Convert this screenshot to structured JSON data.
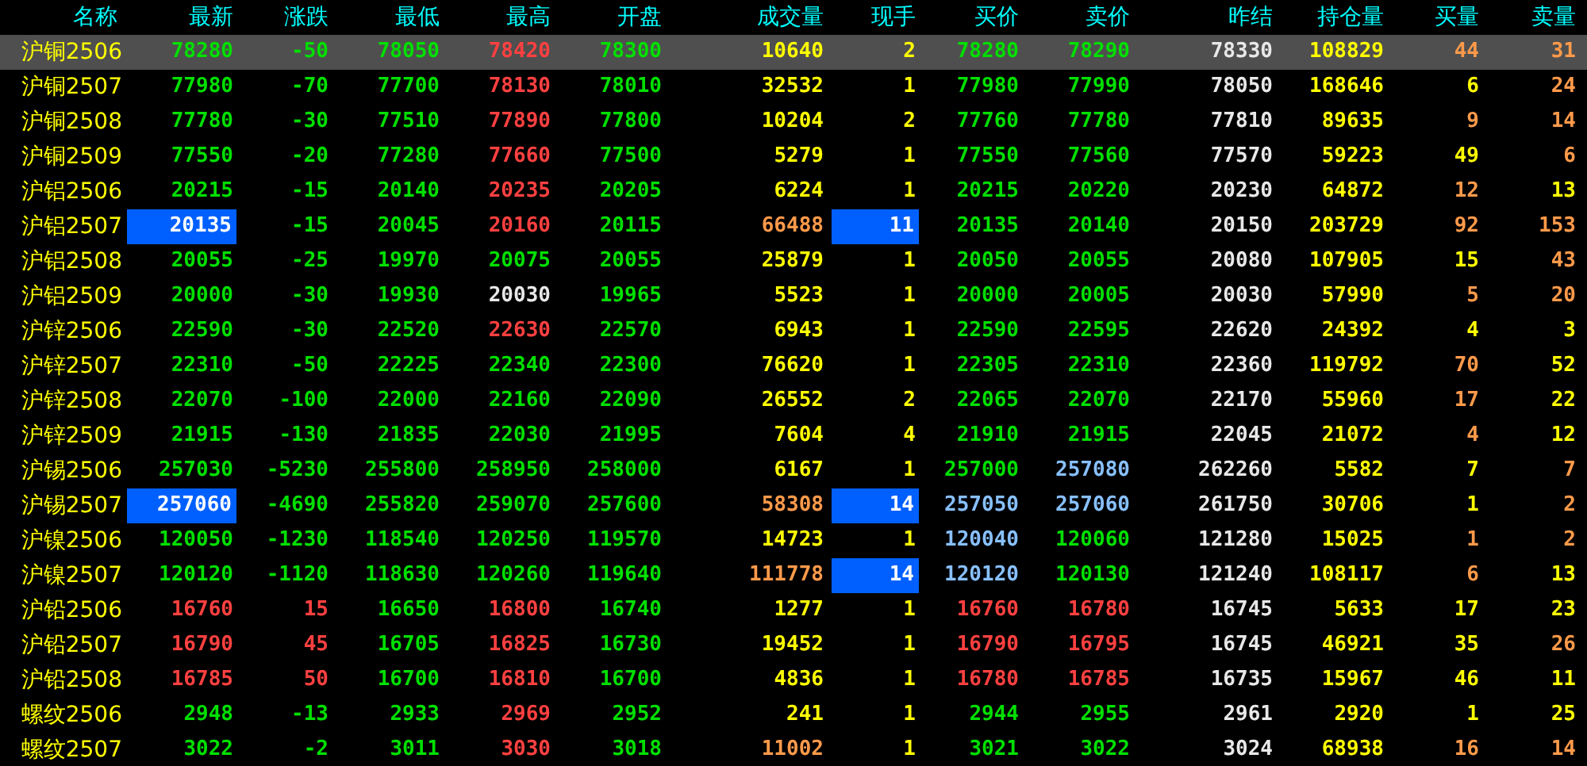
{
  "table": {
    "name_header": "名称",
    "columns": [
      "最新",
      "涨跌",
      "最低",
      "最高",
      "开盘",
      "成交量",
      "现手",
      "买价",
      "卖价",
      "昨结",
      "持仓量",
      "买量",
      "卖量"
    ],
    "rows": [
      {
        "name": "沪铜2506",
        "selected": true,
        "cells": [
          {
            "text": "78280",
            "color": "#00e000",
            "highlighted": false
          },
          {
            "text": "-50",
            "color": "#00e000",
            "highlighted": false
          },
          {
            "text": "78050",
            "color": "#00e000",
            "highlighted": false
          },
          {
            "text": "78420",
            "color": "#ff4040",
            "highlighted": false
          },
          {
            "text": "78300",
            "color": "#00e000",
            "highlighted": false
          },
          {
            "text": "10640",
            "color": "#ffff00",
            "highlighted": false
          },
          {
            "text": "2",
            "color": "#ffff00",
            "highlighted": false
          },
          {
            "text": "78280",
            "color": "#00e000",
            "highlighted": false
          },
          {
            "text": "78290",
            "color": "#00e000",
            "highlighted": false
          },
          {
            "text": "78330",
            "color": "#e8e8e8",
            "highlighted": false
          },
          {
            "text": "108829",
            "color": "#ffff00",
            "highlighted": false
          },
          {
            "text": "44",
            "color": "#ff9a4a",
            "highlighted": false
          },
          {
            "text": "31",
            "color": "#ff9a4a",
            "highlighted": false
          }
        ]
      },
      {
        "name": "沪铜2507",
        "selected": false,
        "cells": [
          {
            "text": "77980",
            "color": "#00e000",
            "highlighted": false
          },
          {
            "text": "-70",
            "color": "#00e000",
            "highlighted": false
          },
          {
            "text": "77700",
            "color": "#00e000",
            "highlighted": false
          },
          {
            "text": "78130",
            "color": "#ff4040",
            "highlighted": false
          },
          {
            "text": "78010",
            "color": "#00e000",
            "highlighted": false
          },
          {
            "text": "32532",
            "color": "#ffff00",
            "highlighted": false
          },
          {
            "text": "1",
            "color": "#ffff00",
            "highlighted": false
          },
          {
            "text": "77980",
            "color": "#00e000",
            "highlighted": false
          },
          {
            "text": "77990",
            "color": "#00e000",
            "highlighted": false
          },
          {
            "text": "78050",
            "color": "#e8e8e8",
            "highlighted": false
          },
          {
            "text": "168646",
            "color": "#ffff00",
            "highlighted": false
          },
          {
            "text": "6",
            "color": "#ffff00",
            "highlighted": false
          },
          {
            "text": "24",
            "color": "#ff9a4a",
            "highlighted": false
          }
        ]
      },
      {
        "name": "沪铜2508",
        "selected": false,
        "cells": [
          {
            "text": "77780",
            "color": "#00e000",
            "highlighted": false
          },
          {
            "text": "-30",
            "color": "#00e000",
            "highlighted": false
          },
          {
            "text": "77510",
            "color": "#00e000",
            "highlighted": false
          },
          {
            "text": "77890",
            "color": "#ff4040",
            "highlighted": false
          },
          {
            "text": "77800",
            "color": "#00e000",
            "highlighted": false
          },
          {
            "text": "10204",
            "color": "#ffff00",
            "highlighted": false
          },
          {
            "text": "2",
            "color": "#ffff00",
            "highlighted": false
          },
          {
            "text": "77760",
            "color": "#00e000",
            "highlighted": false
          },
          {
            "text": "77780",
            "color": "#00e000",
            "highlighted": false
          },
          {
            "text": "77810",
            "color": "#e8e8e8",
            "highlighted": false
          },
          {
            "text": "89635",
            "color": "#ffff00",
            "highlighted": false
          },
          {
            "text": "9",
            "color": "#ff9a4a",
            "highlighted": false
          },
          {
            "text": "14",
            "color": "#ff9a4a",
            "highlighted": false
          }
        ]
      },
      {
        "name": "沪铜2509",
        "selected": false,
        "cells": [
          {
            "text": "77550",
            "color": "#00e000",
            "highlighted": false
          },
          {
            "text": "-20",
            "color": "#00e000",
            "highlighted": false
          },
          {
            "text": "77280",
            "color": "#00e000",
            "highlighted": false
          },
          {
            "text": "77660",
            "color": "#ff4040",
            "highlighted": false
          },
          {
            "text": "77500",
            "color": "#00e000",
            "highlighted": false
          },
          {
            "text": "5279",
            "color": "#ffff00",
            "highlighted": false
          },
          {
            "text": "1",
            "color": "#ffff00",
            "highlighted": false
          },
          {
            "text": "77550",
            "color": "#00e000",
            "highlighted": false
          },
          {
            "text": "77560",
            "color": "#00e000",
            "highlighted": false
          },
          {
            "text": "77570",
            "color": "#e8e8e8",
            "highlighted": false
          },
          {
            "text": "59223",
            "color": "#ffff00",
            "highlighted": false
          },
          {
            "text": "49",
            "color": "#ffff00",
            "highlighted": false
          },
          {
            "text": "6",
            "color": "#ff9a4a",
            "highlighted": false
          }
        ]
      },
      {
        "name": "沪铝2506",
        "selected": false,
        "cells": [
          {
            "text": "20215",
            "color": "#00e000",
            "highlighted": false
          },
          {
            "text": "-15",
            "color": "#00e000",
            "highlighted": false
          },
          {
            "text": "20140",
            "color": "#00e000",
            "highlighted": false
          },
          {
            "text": "20235",
            "color": "#ff4040",
            "highlighted": false
          },
          {
            "text": "20205",
            "color": "#00e000",
            "highlighted": false
          },
          {
            "text": "6224",
            "color": "#ffff00",
            "highlighted": false
          },
          {
            "text": "1",
            "color": "#ffff00",
            "highlighted": false
          },
          {
            "text": "20215",
            "color": "#00e000",
            "highlighted": false
          },
          {
            "text": "20220",
            "color": "#00e000",
            "highlighted": false
          },
          {
            "text": "20230",
            "color": "#e8e8e8",
            "highlighted": false
          },
          {
            "text": "64872",
            "color": "#ffff00",
            "highlighted": false
          },
          {
            "text": "12",
            "color": "#ff9a4a",
            "highlighted": false
          },
          {
            "text": "13",
            "color": "#ffff00",
            "highlighted": false
          }
        ]
      },
      {
        "name": "沪铝2507",
        "selected": false,
        "cells": [
          {
            "text": "20135",
            "color": "#ffffff",
            "highlighted": true
          },
          {
            "text": "-15",
            "color": "#00e000",
            "highlighted": false
          },
          {
            "text": "20045",
            "color": "#00e000",
            "highlighted": false
          },
          {
            "text": "20160",
            "color": "#ff4040",
            "highlighted": false
          },
          {
            "text": "20115",
            "color": "#00e000",
            "highlighted": false
          },
          {
            "text": "66488",
            "color": "#ff9a4a",
            "highlighted": false
          },
          {
            "text": "11",
            "color": "#ffffff",
            "highlighted": true
          },
          {
            "text": "20135",
            "color": "#00e000",
            "highlighted": false
          },
          {
            "text": "20140",
            "color": "#00e000",
            "highlighted": false
          },
          {
            "text": "20150",
            "color": "#e8e8e8",
            "highlighted": false
          },
          {
            "text": "203729",
            "color": "#ffff00",
            "highlighted": false
          },
          {
            "text": "92",
            "color": "#ff9a4a",
            "highlighted": false
          },
          {
            "text": "153",
            "color": "#ff9a4a",
            "highlighted": false
          }
        ]
      },
      {
        "name": "沪铝2508",
        "selected": false,
        "cells": [
          {
            "text": "20055",
            "color": "#00e000",
            "highlighted": false
          },
          {
            "text": "-25",
            "color": "#00e000",
            "highlighted": false
          },
          {
            "text": "19970",
            "color": "#00e000",
            "highlighted": false
          },
          {
            "text": "20075",
            "color": "#00e000",
            "highlighted": false
          },
          {
            "text": "20055",
            "color": "#00e000",
            "highlighted": false
          },
          {
            "text": "25879",
            "color": "#ffff00",
            "highlighted": false
          },
          {
            "text": "1",
            "color": "#ffff00",
            "highlighted": false
          },
          {
            "text": "20050",
            "color": "#00e000",
            "highlighted": false
          },
          {
            "text": "20055",
            "color": "#00e000",
            "highlighted": false
          },
          {
            "text": "20080",
            "color": "#e8e8e8",
            "highlighted": false
          },
          {
            "text": "107905",
            "color": "#ffff00",
            "highlighted": false
          },
          {
            "text": "15",
            "color": "#ffff00",
            "highlighted": false
          },
          {
            "text": "43",
            "color": "#ff9a4a",
            "highlighted": false
          }
        ]
      },
      {
        "name": "沪铝2509",
        "selected": false,
        "cells": [
          {
            "text": "20000",
            "color": "#00e000",
            "highlighted": false
          },
          {
            "text": "-30",
            "color": "#00e000",
            "highlighted": false
          },
          {
            "text": "19930",
            "color": "#00e000",
            "highlighted": false
          },
          {
            "text": "20030",
            "color": "#e8e8e8",
            "highlighted": false
          },
          {
            "text": "19965",
            "color": "#00e000",
            "highlighted": false
          },
          {
            "text": "5523",
            "color": "#ffff00",
            "highlighted": false
          },
          {
            "text": "1",
            "color": "#ffff00",
            "highlighted": false
          },
          {
            "text": "20000",
            "color": "#00e000",
            "highlighted": false
          },
          {
            "text": "20005",
            "color": "#00e000",
            "highlighted": false
          },
          {
            "text": "20030",
            "color": "#e8e8e8",
            "highlighted": false
          },
          {
            "text": "57990",
            "color": "#ffff00",
            "highlighted": false
          },
          {
            "text": "5",
            "color": "#ff9a4a",
            "highlighted": false
          },
          {
            "text": "20",
            "color": "#ff9a4a",
            "highlighted": false
          }
        ]
      },
      {
        "name": "沪锌2506",
        "selected": false,
        "cells": [
          {
            "text": "22590",
            "color": "#00e000",
            "highlighted": false
          },
          {
            "text": "-30",
            "color": "#00e000",
            "highlighted": false
          },
          {
            "text": "22520",
            "color": "#00e000",
            "highlighted": false
          },
          {
            "text": "22630",
            "color": "#ff4040",
            "highlighted": false
          },
          {
            "text": "22570",
            "color": "#00e000",
            "highlighted": false
          },
          {
            "text": "6943",
            "color": "#ffff00",
            "highlighted": false
          },
          {
            "text": "1",
            "color": "#ffff00",
            "highlighted": false
          },
          {
            "text": "22590",
            "color": "#00e000",
            "highlighted": false
          },
          {
            "text": "22595",
            "color": "#00e000",
            "highlighted": false
          },
          {
            "text": "22620",
            "color": "#e8e8e8",
            "highlighted": false
          },
          {
            "text": "24392",
            "color": "#ffff00",
            "highlighted": false
          },
          {
            "text": "4",
            "color": "#ffff00",
            "highlighted": false
          },
          {
            "text": "3",
            "color": "#ffff00",
            "highlighted": false
          }
        ]
      },
      {
        "name": "沪锌2507",
        "selected": false,
        "cells": [
          {
            "text": "22310",
            "color": "#00e000",
            "highlighted": false
          },
          {
            "text": "-50",
            "color": "#00e000",
            "highlighted": false
          },
          {
            "text": "22225",
            "color": "#00e000",
            "highlighted": false
          },
          {
            "text": "22340",
            "color": "#00e000",
            "highlighted": false
          },
          {
            "text": "22300",
            "color": "#00e000",
            "highlighted": false
          },
          {
            "text": "76620",
            "color": "#ffff00",
            "highlighted": false
          },
          {
            "text": "1",
            "color": "#ffff00",
            "highlighted": false
          },
          {
            "text": "22305",
            "color": "#00e000",
            "highlighted": false
          },
          {
            "text": "22310",
            "color": "#00e000",
            "highlighted": false
          },
          {
            "text": "22360",
            "color": "#e8e8e8",
            "highlighted": false
          },
          {
            "text": "119792",
            "color": "#ffff00",
            "highlighted": false
          },
          {
            "text": "70",
            "color": "#ff9a4a",
            "highlighted": false
          },
          {
            "text": "52",
            "color": "#ffff00",
            "highlighted": false
          }
        ]
      },
      {
        "name": "沪锌2508",
        "selected": false,
        "cells": [
          {
            "text": "22070",
            "color": "#00e000",
            "highlighted": false
          },
          {
            "text": "-100",
            "color": "#00e000",
            "highlighted": false
          },
          {
            "text": "22000",
            "color": "#00e000",
            "highlighted": false
          },
          {
            "text": "22160",
            "color": "#00e000",
            "highlighted": false
          },
          {
            "text": "22090",
            "color": "#00e000",
            "highlighted": false
          },
          {
            "text": "26552",
            "color": "#ffff00",
            "highlighted": false
          },
          {
            "text": "2",
            "color": "#ffff00",
            "highlighted": false
          },
          {
            "text": "22065",
            "color": "#00e000",
            "highlighted": false
          },
          {
            "text": "22070",
            "color": "#00e000",
            "highlighted": false
          },
          {
            "text": "22170",
            "color": "#e8e8e8",
            "highlighted": false
          },
          {
            "text": "55960",
            "color": "#ffff00",
            "highlighted": false
          },
          {
            "text": "17",
            "color": "#ff9a4a",
            "highlighted": false
          },
          {
            "text": "22",
            "color": "#ffff00",
            "highlighted": false
          }
        ]
      },
      {
        "name": "沪锌2509",
        "selected": false,
        "cells": [
          {
            "text": "21915",
            "color": "#00e000",
            "highlighted": false
          },
          {
            "text": "-130",
            "color": "#00e000",
            "highlighted": false
          },
          {
            "text": "21835",
            "color": "#00e000",
            "highlighted": false
          },
          {
            "text": "22030",
            "color": "#00e000",
            "highlighted": false
          },
          {
            "text": "21995",
            "color": "#00e000",
            "highlighted": false
          },
          {
            "text": "7604",
            "color": "#ffff00",
            "highlighted": false
          },
          {
            "text": "4",
            "color": "#ffff00",
            "highlighted": false
          },
          {
            "text": "21910",
            "color": "#00e000",
            "highlighted": false
          },
          {
            "text": "21915",
            "color": "#00e000",
            "highlighted": false
          },
          {
            "text": "22045",
            "color": "#e8e8e8",
            "highlighted": false
          },
          {
            "text": "21072",
            "color": "#ffff00",
            "highlighted": false
          },
          {
            "text": "4",
            "color": "#ff9a4a",
            "highlighted": false
          },
          {
            "text": "12",
            "color": "#ffff00",
            "highlighted": false
          }
        ]
      },
      {
        "name": "沪锡2506",
        "selected": false,
        "cells": [
          {
            "text": "257030",
            "color": "#00e000",
            "highlighted": false
          },
          {
            "text": "-5230",
            "color": "#00e000",
            "highlighted": false
          },
          {
            "text": "255800",
            "color": "#00e000",
            "highlighted": false
          },
          {
            "text": "258950",
            "color": "#00e000",
            "highlighted": false
          },
          {
            "text": "258000",
            "color": "#00e000",
            "highlighted": false
          },
          {
            "text": "6167",
            "color": "#ffff00",
            "highlighted": false
          },
          {
            "text": "1",
            "color": "#ffff00",
            "highlighted": false
          },
          {
            "text": "257000",
            "color": "#00e000",
            "highlighted": false
          },
          {
            "text": "257080",
            "color": "#88c0ff",
            "highlighted": false
          },
          {
            "text": "262260",
            "color": "#e8e8e8",
            "highlighted": false
          },
          {
            "text": "5582",
            "color": "#ffff00",
            "highlighted": false
          },
          {
            "text": "7",
            "color": "#ffff00",
            "highlighted": false
          },
          {
            "text": "7",
            "color": "#ff9a4a",
            "highlighted": false
          }
        ]
      },
      {
        "name": "沪锡2507",
        "selected": false,
        "cells": [
          {
            "text": "257060",
            "color": "#ffffff",
            "highlighted": true
          },
          {
            "text": "-4690",
            "color": "#00e000",
            "highlighted": false
          },
          {
            "text": "255820",
            "color": "#00e000",
            "highlighted": false
          },
          {
            "text": "259070",
            "color": "#00e000",
            "highlighted": false
          },
          {
            "text": "257600",
            "color": "#00e000",
            "highlighted": false
          },
          {
            "text": "58308",
            "color": "#ff9a4a",
            "highlighted": false
          },
          {
            "text": "14",
            "color": "#ffffff",
            "highlighted": true
          },
          {
            "text": "257050",
            "color": "#88c0ff",
            "highlighted": false
          },
          {
            "text": "257060",
            "color": "#88c0ff",
            "highlighted": false
          },
          {
            "text": "261750",
            "color": "#e8e8e8",
            "highlighted": false
          },
          {
            "text": "30706",
            "color": "#ffff00",
            "highlighted": false
          },
          {
            "text": "1",
            "color": "#ffff00",
            "highlighted": false
          },
          {
            "text": "2",
            "color": "#ff9a4a",
            "highlighted": false
          }
        ]
      },
      {
        "name": "沪镍2506",
        "selected": false,
        "cells": [
          {
            "text": "120050",
            "color": "#00e000",
            "highlighted": false
          },
          {
            "text": "-1230",
            "color": "#00e000",
            "highlighted": false
          },
          {
            "text": "118540",
            "color": "#00e000",
            "highlighted": false
          },
          {
            "text": "120250",
            "color": "#00e000",
            "highlighted": false
          },
          {
            "text": "119570",
            "color": "#00e000",
            "highlighted": false
          },
          {
            "text": "14723",
            "color": "#ffff00",
            "highlighted": false
          },
          {
            "text": "1",
            "color": "#ffff00",
            "highlighted": false
          },
          {
            "text": "120040",
            "color": "#88c0ff",
            "highlighted": false
          },
          {
            "text": "120060",
            "color": "#00e000",
            "highlighted": false
          },
          {
            "text": "121280",
            "color": "#e8e8e8",
            "highlighted": false
          },
          {
            "text": "15025",
            "color": "#ffff00",
            "highlighted": false
          },
          {
            "text": "1",
            "color": "#ff9a4a",
            "highlighted": false
          },
          {
            "text": "2",
            "color": "#ff9a4a",
            "highlighted": false
          }
        ]
      },
      {
        "name": "沪镍2507",
        "selected": false,
        "cells": [
          {
            "text": "120120",
            "color": "#00e000",
            "highlighted": false
          },
          {
            "text": "-1120",
            "color": "#00e000",
            "highlighted": false
          },
          {
            "text": "118630",
            "color": "#00e000",
            "highlighted": false
          },
          {
            "text": "120260",
            "color": "#00e000",
            "highlighted": false
          },
          {
            "text": "119640",
            "color": "#00e000",
            "highlighted": false
          },
          {
            "text": "111778",
            "color": "#ff9a4a",
            "highlighted": false
          },
          {
            "text": "14",
            "color": "#ffffff",
            "highlighted": true
          },
          {
            "text": "120120",
            "color": "#88c0ff",
            "highlighted": false
          },
          {
            "text": "120130",
            "color": "#00e000",
            "highlighted": false
          },
          {
            "text": "121240",
            "color": "#e8e8e8",
            "highlighted": false
          },
          {
            "text": "108117",
            "color": "#ffff00",
            "highlighted": false
          },
          {
            "text": "6",
            "color": "#ff9a4a",
            "highlighted": false
          },
          {
            "text": "13",
            "color": "#ffff00",
            "highlighted": false
          }
        ]
      },
      {
        "name": "沪铅2506",
        "selected": false,
        "cells": [
          {
            "text": "16760",
            "color": "#ff4040",
            "highlighted": false
          },
          {
            "text": "15",
            "color": "#ff4040",
            "highlighted": false
          },
          {
            "text": "16650",
            "color": "#00e000",
            "highlighted": false
          },
          {
            "text": "16800",
            "color": "#ff4040",
            "highlighted": false
          },
          {
            "text": "16740",
            "color": "#00e000",
            "highlighted": false
          },
          {
            "text": "1277",
            "color": "#ffff00",
            "highlighted": false
          },
          {
            "text": "1",
            "color": "#ffff00",
            "highlighted": false
          },
          {
            "text": "16760",
            "color": "#ff4040",
            "highlighted": false
          },
          {
            "text": "16780",
            "color": "#ff4040",
            "highlighted": false
          },
          {
            "text": "16745",
            "color": "#e8e8e8",
            "highlighted": false
          },
          {
            "text": "5633",
            "color": "#ffff00",
            "highlighted": false
          },
          {
            "text": "17",
            "color": "#ffff00",
            "highlighted": false
          },
          {
            "text": "23",
            "color": "#ffff00",
            "highlighted": false
          }
        ]
      },
      {
        "name": "沪铅2507",
        "selected": false,
        "cells": [
          {
            "text": "16790",
            "color": "#ff4040",
            "highlighted": false
          },
          {
            "text": "45",
            "color": "#ff4040",
            "highlighted": false
          },
          {
            "text": "16705",
            "color": "#00e000",
            "highlighted": false
          },
          {
            "text": "16825",
            "color": "#ff4040",
            "highlighted": false
          },
          {
            "text": "16730",
            "color": "#00e000",
            "highlighted": false
          },
          {
            "text": "19452",
            "color": "#ffff00",
            "highlighted": false
          },
          {
            "text": "1",
            "color": "#ffff00",
            "highlighted": false
          },
          {
            "text": "16790",
            "color": "#ff4040",
            "highlighted": false
          },
          {
            "text": "16795",
            "color": "#ff4040",
            "highlighted": false
          },
          {
            "text": "16745",
            "color": "#e8e8e8",
            "highlighted": false
          },
          {
            "text": "46921",
            "color": "#ffff00",
            "highlighted": false
          },
          {
            "text": "35",
            "color": "#ffff00",
            "highlighted": false
          },
          {
            "text": "26",
            "color": "#ff9a4a",
            "highlighted": false
          }
        ]
      },
      {
        "name": "沪铅2508",
        "selected": false,
        "cells": [
          {
            "text": "16785",
            "color": "#ff4040",
            "highlighted": false
          },
          {
            "text": "50",
            "color": "#ff4040",
            "highlighted": false
          },
          {
            "text": "16700",
            "color": "#00e000",
            "highlighted": false
          },
          {
            "text": "16810",
            "color": "#ff4040",
            "highlighted": false
          },
          {
            "text": "16700",
            "color": "#00e000",
            "highlighted": false
          },
          {
            "text": "4836",
            "color": "#ffff00",
            "highlighted": false
          },
          {
            "text": "1",
            "color": "#ffff00",
            "highlighted": false
          },
          {
            "text": "16780",
            "color": "#ff4040",
            "highlighted": false
          },
          {
            "text": "16785",
            "color": "#ff4040",
            "highlighted": false
          },
          {
            "text": "16735",
            "color": "#e8e8e8",
            "highlighted": false
          },
          {
            "text": "15967",
            "color": "#ffff00",
            "highlighted": false
          },
          {
            "text": "46",
            "color": "#ffff00",
            "highlighted": false
          },
          {
            "text": "11",
            "color": "#ffff00",
            "highlighted": false
          }
        ]
      },
      {
        "name": "螺纹2506",
        "selected": false,
        "cells": [
          {
            "text": "2948",
            "color": "#00e000",
            "highlighted": false
          },
          {
            "text": "-13",
            "color": "#00e000",
            "highlighted": false
          },
          {
            "text": "2933",
            "color": "#00e000",
            "highlighted": false
          },
          {
            "text": "2969",
            "color": "#ff4040",
            "highlighted": false
          },
          {
            "text": "2952",
            "color": "#00e000",
            "highlighted": false
          },
          {
            "text": "241",
            "color": "#ffff00",
            "highlighted": false
          },
          {
            "text": "1",
            "color": "#ffff00",
            "highlighted": false
          },
          {
            "text": "2944",
            "color": "#00e000",
            "highlighted": false
          },
          {
            "text": "2955",
            "color": "#00e000",
            "highlighted": false
          },
          {
            "text": "2961",
            "color": "#e8e8e8",
            "highlighted": false
          },
          {
            "text": "2920",
            "color": "#ffff00",
            "highlighted": false
          },
          {
            "text": "1",
            "color": "#ffff00",
            "highlighted": false
          },
          {
            "text": "25",
            "color": "#ffff00",
            "highlighted": false
          }
        ]
      },
      {
        "name": "螺纹2507",
        "selected": false,
        "cells": [
          {
            "text": "3022",
            "color": "#00e000",
            "highlighted": false
          },
          {
            "text": "-2",
            "color": "#00e000",
            "highlighted": false
          },
          {
            "text": "3011",
            "color": "#00e000",
            "highlighted": false
          },
          {
            "text": "3030",
            "color": "#ff4040",
            "highlighted": false
          },
          {
            "text": "3018",
            "color": "#00e000",
            "highlighted": false
          },
          {
            "text": "11002",
            "color": "#ff9a4a",
            "highlighted": false
          },
          {
            "text": "1",
            "color": "#ffff00",
            "highlighted": false
          },
          {
            "text": "3021",
            "color": "#00e000",
            "highlighted": false
          },
          {
            "text": "3022",
            "color": "#00e000",
            "highlighted": false
          },
          {
            "text": "3024",
            "color": "#e8e8e8",
            "highlighted": false
          },
          {
            "text": "68938",
            "color": "#ffff00",
            "highlighted": false
          },
          {
            "text": "16",
            "color": "#ff9a4a",
            "highlighted": false
          },
          {
            "text": "14",
            "color": "#ff9a4a",
            "highlighted": false
          }
        ]
      }
    ]
  }
}
